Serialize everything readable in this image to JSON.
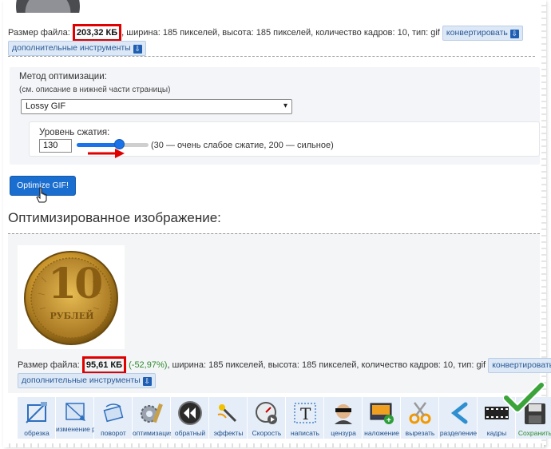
{
  "original": {
    "size_label": "Размер файла:",
    "size_value": "203,32 КБ",
    "details": ", ширина: 185 пикселей, высота: 185 пикселей, количество кадров: 10, тип: gif",
    "convert_label": "конвертировать",
    "more_tools_label": "дополнительные инструменты"
  },
  "optimization": {
    "method_label": "Метод оптимизации:",
    "method_hint": "(см. описание в нижней части страницы)",
    "method_selected": "Lossy GIF",
    "compression_label": "Уровень сжатия:",
    "compression_value": "130",
    "compression_hint": "(30 — очень слабое сжатие, 200 — сильное)",
    "slider": {
      "min": 30,
      "max": 200,
      "value": 130
    },
    "button_label": "Optimize GIF!"
  },
  "result": {
    "title": "Оптимизированное изображение:",
    "coin_denomination": "10",
    "coin_word": "РУБЛЕЙ",
    "size_label": "Размер файла:",
    "size_value": "95,61 КБ",
    "savings": "-52,97%",
    "details": ", ширина: 185 пикселей, высота: 185 пикселей, количество кадров: 10, тип: gif",
    "convert_label": "конвертировать",
    "more_tools_label": "дополнительные инструменты"
  },
  "toolbar": [
    {
      "label": "обрезка",
      "icon": "crop-icon"
    },
    {
      "label": "изменение размера",
      "icon": "resize-icon"
    },
    {
      "label": "поворот",
      "icon": "rotate-icon"
    },
    {
      "label": "оптимизация",
      "icon": "optimize-icon"
    },
    {
      "label": "обратный",
      "icon": "reverse-icon"
    },
    {
      "label": "эффекты",
      "icon": "effects-wand-icon"
    },
    {
      "label": "Скорость",
      "icon": "speed-icon"
    },
    {
      "label": "написать",
      "icon": "text-icon"
    },
    {
      "label": "цензура",
      "icon": "censor-icon"
    },
    {
      "label": "наложение",
      "icon": "overlay-icon"
    },
    {
      "label": "вырезать",
      "icon": "scissors-icon"
    },
    {
      "label": "разделение",
      "icon": "split-icon"
    },
    {
      "label": "кадры",
      "icon": "frames-icon"
    },
    {
      "label": "Сохранить",
      "icon": "save-icon"
    }
  ],
  "colors": {
    "accent": "#1a6ed0",
    "highlight_border": "#e00000",
    "savings": "#2e8b2e",
    "arrow": "#e00000",
    "checkmark": "#3aa33a"
  }
}
